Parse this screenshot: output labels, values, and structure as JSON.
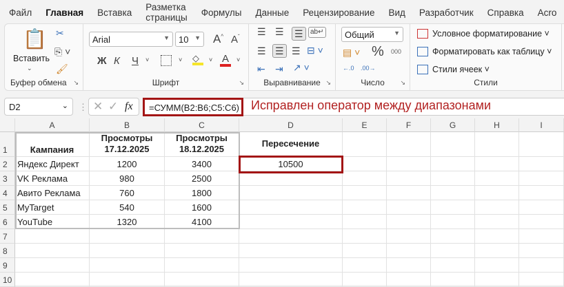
{
  "menu": [
    "Файл",
    "Главная",
    "Вставка",
    "Разметка страницы",
    "Формулы",
    "Данные",
    "Рецензирование",
    "Вид",
    "Разработчик",
    "Справка",
    "Acro"
  ],
  "ribbon": {
    "clipboard": {
      "paste": "Вставить",
      "label": "Буфер обмена"
    },
    "font": {
      "name": "Arial",
      "size": "10",
      "bold": "Ж",
      "italic": "К",
      "underline": "Ч",
      "label": "Шрифт"
    },
    "alignment": {
      "label": "Выравнивание"
    },
    "number": {
      "format": "Общий",
      "percent": "%",
      "thousands": "000",
      "label": "Число"
    },
    "styles": {
      "conditional": "Условное форматирование",
      "as_table": "Форматировать как таблицу",
      "cell_styles": "Стили ячеек",
      "label": "Стили"
    }
  },
  "formula_bar": {
    "name_box": "D2",
    "fx": "fx",
    "formula": "=СУММ(B2:B6;C5:C6)",
    "note": "Исправлен оператор между диапазонами"
  },
  "columns": [
    "A",
    "B",
    "C",
    "D",
    "E",
    "F",
    "G",
    "H",
    "I"
  ],
  "rows": [
    "1",
    "2",
    "3",
    "4",
    "5",
    "6",
    "7",
    "8",
    "9",
    "10"
  ],
  "header": {
    "a": "Кампания",
    "b1": "Просмотры",
    "b2": "17.12.2025",
    "c1": "Просмотры",
    "c2": "18.12.2025",
    "d": "Пересечение"
  },
  "data": [
    {
      "name": "Яндекс Директ",
      "b": "1200",
      "c": "3400",
      "d": "10500"
    },
    {
      "name": "VK Реклама",
      "b": "980",
      "c": "2500"
    },
    {
      "name": "Авито Реклама",
      "b": "760",
      "c": "1800"
    },
    {
      "name": "MyTarget",
      "b": "540",
      "c": "1600"
    },
    {
      "name": "YouTube",
      "b": "1320",
      "c": "4100"
    }
  ]
}
